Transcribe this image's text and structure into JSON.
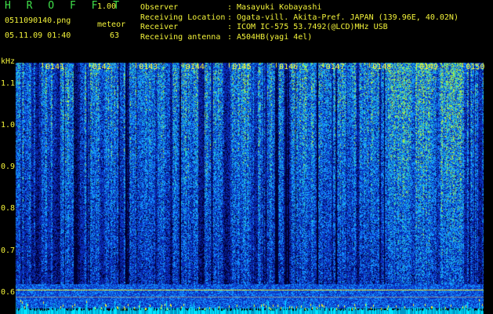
{
  "header": {
    "app_title": "H R O F F T",
    "app_version": "1.00",
    "file_name": "0511090140.png",
    "meteor_label": "meteor",
    "date_time": "05.11.09 01:40",
    "meteor_count": "63"
  },
  "info": [
    {
      "key": "Observer",
      "sep": ":",
      "value": "Masayuki Kobayashi"
    },
    {
      "key": "Receiving Location",
      "sep": ":",
      "value": "Ogata-vill. Akita-Pref. JAPAN (139.96E, 40.02N)"
    },
    {
      "key": "Receiver",
      "sep": ":",
      "value": "ICOM IC-575 53.7492(@LCD)MHz USB"
    },
    {
      "key": "Receiving antenna",
      "sep": ":",
      "value": "A504HB(yagi 4el)"
    }
  ],
  "chart_data": {
    "type": "heatmap",
    "ylabel": "kHz",
    "yticks": [
      "1.1",
      "1.0",
      "0.9",
      "0.8",
      "0.7",
      "0.6"
    ],
    "ylim": [
      0.6,
      1.15
    ],
    "xticks": [
      "0141",
      "0142",
      "0143",
      "0144",
      "0145",
      "0146",
      "0147",
      "0148",
      "0149",
      "0150"
    ],
    "colors": {
      "background": "#000000",
      "low": "#0a1a7a",
      "mid": "#1e5aff",
      "high": "#30d2c8",
      "peak": "#b4f04a",
      "trace": "#f0f028",
      "baseline": "#00e6ff"
    }
  }
}
